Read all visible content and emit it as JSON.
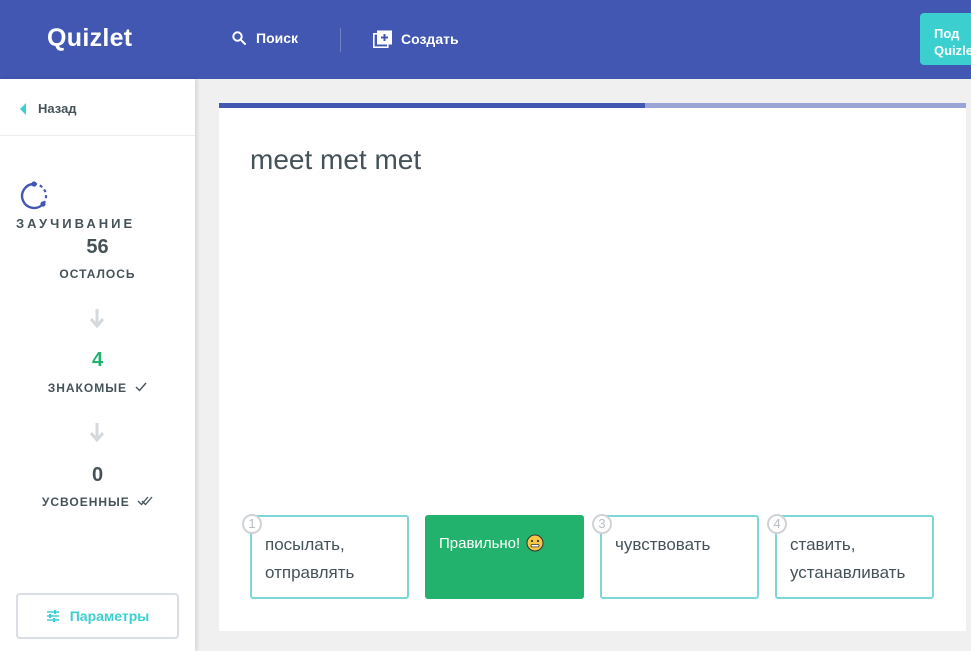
{
  "header": {
    "logo": "Quizlet",
    "search_label": "Поиск",
    "create_label": "Создать",
    "upgrade_label": "Под\nQuizle"
  },
  "sidebar": {
    "back_label": "Назад",
    "mode_title": "ЗАУЧИВАНИЕ",
    "remaining_count": "56",
    "remaining_label": "ОСТАЛОСЬ",
    "familiar_count": "4",
    "familiar_label": "ЗНАКОМЫЕ",
    "mastered_count": "0",
    "mastered_label": "УСВОЕННЫЕ",
    "params_label": "Параметры"
  },
  "progress": {
    "fraction": 0.57
  },
  "question": {
    "term": "meet met met"
  },
  "answers": [
    {
      "number": "1",
      "text": "посылать, отправлять",
      "state": "default"
    },
    {
      "number": "2",
      "text": "Правильно!",
      "state": "correct"
    },
    {
      "number": "3",
      "text": "чувствовать",
      "state": "default"
    },
    {
      "number": "4",
      "text": "ставить, устанавливать",
      "state": "default"
    }
  ],
  "colors": {
    "header_bg": "#4257b2",
    "accent_teal": "#3ccfcf",
    "correct_green": "#23b26d",
    "familiar_green": "#23b26d"
  },
  "icons": {
    "search": "search-icon",
    "create": "add-box-icon",
    "back": "back-triangle-icon",
    "learn": "learn-progress-icon",
    "arrow": "arrow-down-icon",
    "check": "check-icon",
    "double_check": "double-check-icon",
    "params": "sliders-icon",
    "emoji": "smiley-emoji"
  }
}
